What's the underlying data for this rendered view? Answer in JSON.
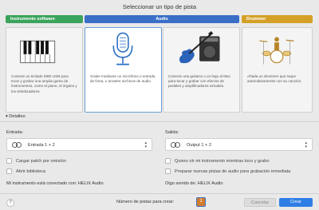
{
  "dialog": {
    "title": "Seleccionar un tipo de pista"
  },
  "tiles": [
    {
      "header": "Instrumento software",
      "color": "#3aa35c",
      "desc": "Conecte un teclado MIDI USB para tocar y grabar una amplia gama de instrumentos, como el piano, el órgano y los sintetizadores.",
      "icon": "keyboard-icon"
    },
    {
      "header": "Audio",
      "color": "#3a6fc8",
      "desc": "Grabe mediante un micrófono o entrada de línea, o arrastre archivos de audio.",
      "icon": "microphone-icon"
    },
    {
      "header": "Drummer",
      "color": "#d5a027",
      "desc": "Añada un drummer que toque automáticamente con su canción.",
      "icon": "drum-kit-icon"
    }
  ],
  "guitar_tile": {
    "desc": "Conecte una guitarra o un bajo al Mac para tocar y grabar con efectos de pedales y amplificadores virtuales.",
    "icon": "guitar-amp-icon"
  },
  "details_label": "▾ Detalles:",
  "input": {
    "label": "Entrada:",
    "value": "Entrada 1 + 2"
  },
  "output": {
    "label": "Salida:",
    "value": "Output 1 + 2"
  },
  "checkboxes": {
    "load_patch": "Cargar patch por omisión",
    "open_library": "Abrir biblioteca",
    "monitor": "Quiero oír mi instrumento mientras toco y grabo",
    "prepare": "Preparar nuevas pistas de audio para grabación inmediata"
  },
  "connected_text": "Mi instrumento está conectado con: HELIX Audio",
  "hear_text": "Oigo sonido de: HELIX Audio",
  "num_tracks": {
    "label": "Número de pistas para crear:",
    "value": "1"
  },
  "buttons": {
    "help": "?",
    "cancel": "Cancelar",
    "create": "Crear"
  }
}
